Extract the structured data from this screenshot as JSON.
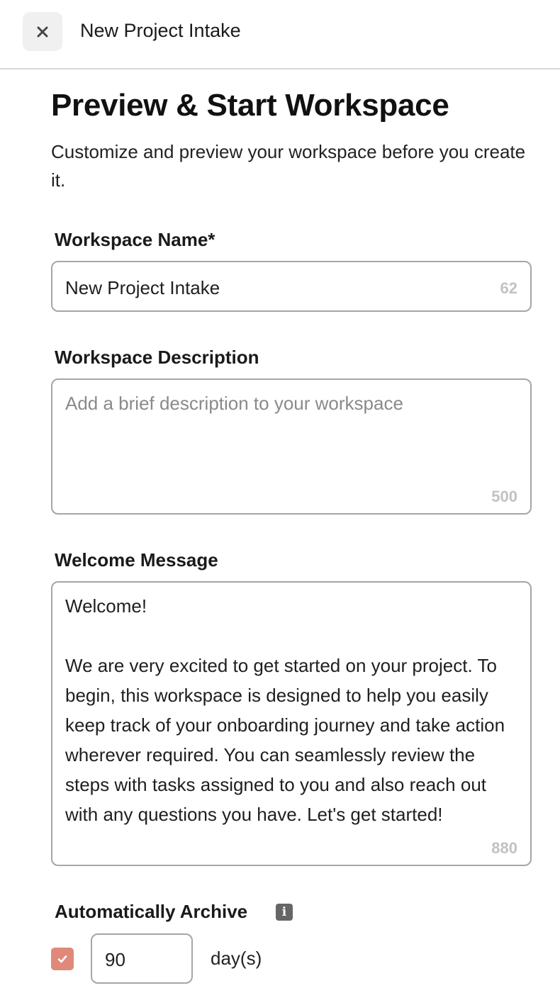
{
  "header": {
    "close_icon": "close-icon",
    "title": "New Project Intake"
  },
  "page": {
    "title": "Preview & Start Workspace",
    "subtitle": "Customize and preview your workspace before you create it."
  },
  "workspace_name": {
    "label": "Workspace Name*",
    "value": "New Project Intake",
    "remaining": "62"
  },
  "workspace_description": {
    "label": "Workspace Description",
    "placeholder": "Add a brief description to your workspace",
    "value": "",
    "remaining": "500"
  },
  "welcome_message": {
    "label": "Welcome Message",
    "value": "Welcome!\n\nWe are very excited to get started on your project. To begin, this workspace is designed to help you easily keep track of your onboarding journey and take action wherever required. You can seamlessly review the steps with tasks assigned to you and also reach out with any questions you have. Let's get started!",
    "remaining": "880"
  },
  "auto_archive": {
    "label": "Automatically Archive",
    "info_icon": "info-icon",
    "enabled": true,
    "days_value": "90",
    "unit": "day(s)"
  },
  "colors": {
    "checkbox_accent": "#e0897a",
    "border": "#a6a6a6",
    "counter": "#c2c2c2"
  }
}
